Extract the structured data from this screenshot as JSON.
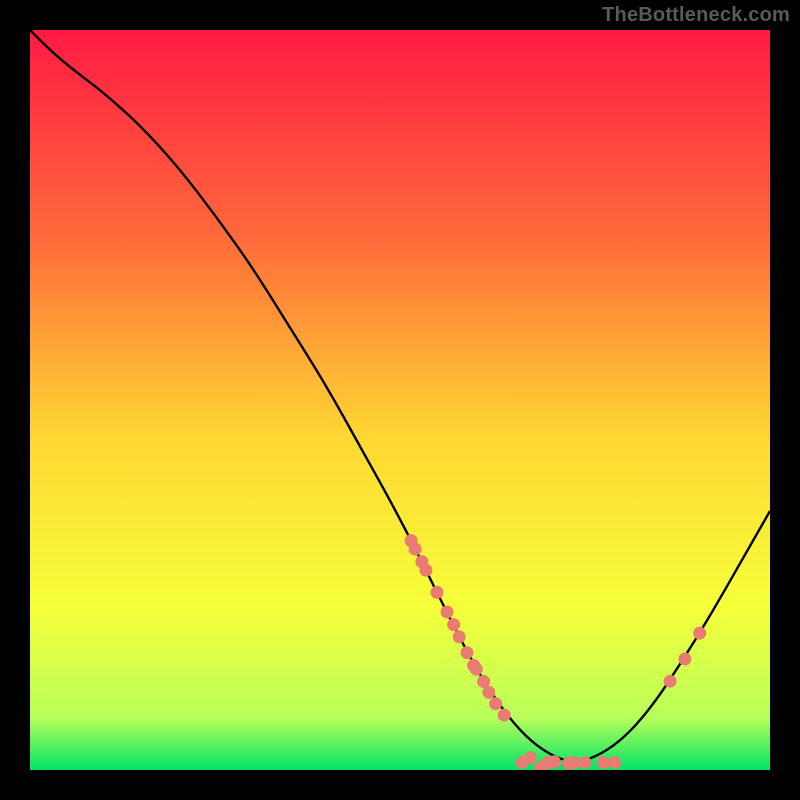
{
  "attribution": "TheBottleneck.com",
  "colors": {
    "background": "#000000",
    "attribution_text": "#5a5a5a",
    "curve": "#000000",
    "dot_fill": "#e97c72",
    "grad_top": "#ff1a44",
    "grad_upper": "#ff6a3a",
    "grad_mid": "#ffd733",
    "grad_lower": "#f6ff3a",
    "grad_green_top": "#b8ff5a",
    "grad_green_bottom": "#00e466"
  },
  "chart_data": {
    "type": "line",
    "title": "",
    "xlabel": "",
    "ylabel": "",
    "xlim": [
      0,
      100
    ],
    "ylim": [
      0,
      100
    ],
    "curve": {
      "x": [
        0,
        3,
        6,
        10,
        15,
        20,
        25,
        30,
        35,
        40,
        45,
        50,
        55,
        58,
        61,
        64,
        67,
        70,
        73,
        76,
        80,
        84,
        88,
        92,
        96,
        100
      ],
      "y": [
        100,
        97,
        94.5,
        91.5,
        87,
        81.5,
        75,
        68,
        60,
        52,
        43,
        34,
        24,
        18,
        12.5,
        8,
        4.5,
        2.2,
        1.0,
        1.5,
        4,
        8.5,
        14.5,
        21,
        28,
        35
      ]
    },
    "dots": [
      {
        "type": "single",
        "x": 51.5,
        "y": 31
      },
      {
        "type": "dash",
        "x": 52.5,
        "y": 29
      },
      {
        "type": "single",
        "x": 53.5,
        "y": 27
      },
      {
        "type": "single",
        "x": 55.0,
        "y": 24
      },
      {
        "type": "dash",
        "x": 56.8,
        "y": 20.5
      },
      {
        "type": "single",
        "x": 58.0,
        "y": 18
      },
      {
        "type": "dash",
        "x": 59.5,
        "y": 15
      },
      {
        "type": "dash",
        "x": 60.8,
        "y": 12.8
      },
      {
        "type": "single",
        "x": 62.0,
        "y": 10.5
      },
      {
        "type": "dash",
        "x": 63.5,
        "y": 8.2
      },
      {
        "type": "single",
        "x": 66.5,
        "y": 1.0
      },
      {
        "type": "dash",
        "x": 68.3,
        "y": 1.0
      },
      {
        "type": "single",
        "x": 70.0,
        "y": 1.0
      },
      {
        "type": "dash",
        "x": 71.8,
        "y": 1.0
      },
      {
        "type": "single",
        "x": 73.5,
        "y": 1.0
      },
      {
        "type": "single",
        "x": 75.0,
        "y": 1.0
      },
      {
        "type": "single",
        "x": 77.5,
        "y": 1.0
      },
      {
        "type": "single",
        "x": 79.0,
        "y": 1.0
      },
      {
        "type": "single",
        "x": 86.5,
        "y": 12.0
      },
      {
        "type": "single",
        "x": 88.5,
        "y": 15.0
      },
      {
        "type": "single",
        "x": 90.5,
        "y": 18.5
      }
    ]
  }
}
